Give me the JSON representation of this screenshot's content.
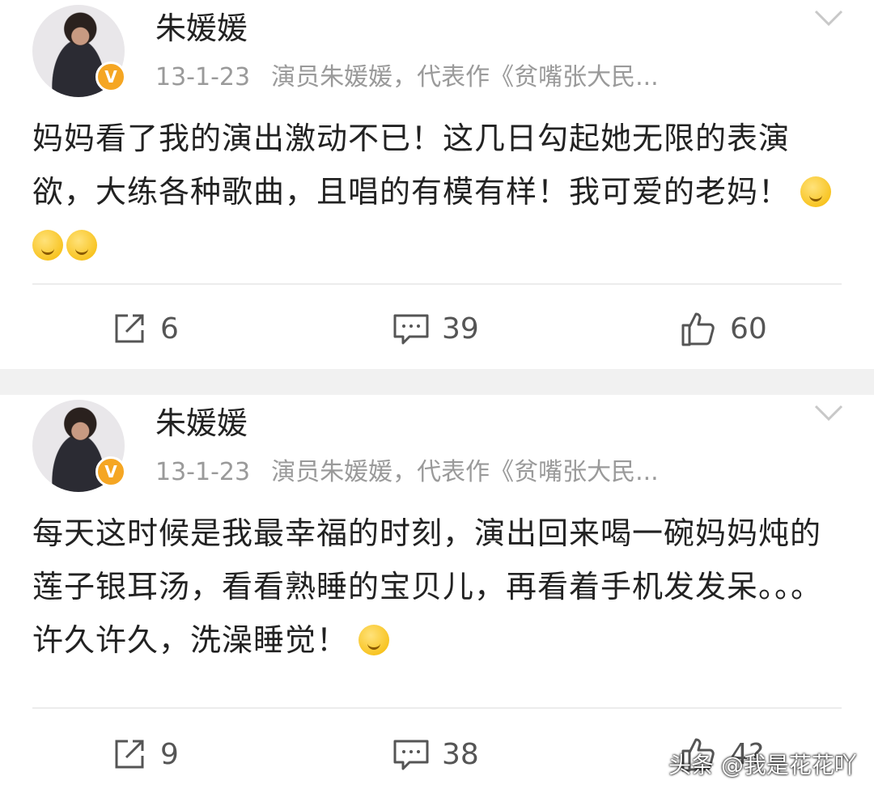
{
  "posts": [
    {
      "username": "朱媛媛",
      "date": "13-1-23",
      "bio": "演员朱媛媛，代表作《贫嘴张大民...",
      "verified_badge": "V",
      "content": "妈妈看了我的演出激动不已！这几日勾起她无限的表演欲，大练各种歌曲，且唱的有模有样！我可爱的老妈！",
      "emojis": [
        "kiss-emoji",
        "smile-emoji",
        "shy-emoji"
      ],
      "shares": "6",
      "comments": "39",
      "likes": "60"
    },
    {
      "username": "朱媛媛",
      "date": "13-1-23",
      "bio": "演员朱媛媛，代表作《贫嘴张大民...",
      "verified_badge": "V",
      "content": "每天这时候是我最幸福的时刻，演出回来喝一碗妈妈炖的莲子银耳汤，看看熟睡的宝贝儿，再看着手机发发呆。。。许久许久，洗澡睡觉！",
      "emojis": [
        "happy-emoji"
      ],
      "shares": "9",
      "comments": "38",
      "likes": "4?"
    }
  ],
  "watermark": "头条 @我是花花吖",
  "colors": {
    "badge": "#f5a623",
    "separator": "#f1f1f1",
    "meta": "#9a9a9a"
  }
}
